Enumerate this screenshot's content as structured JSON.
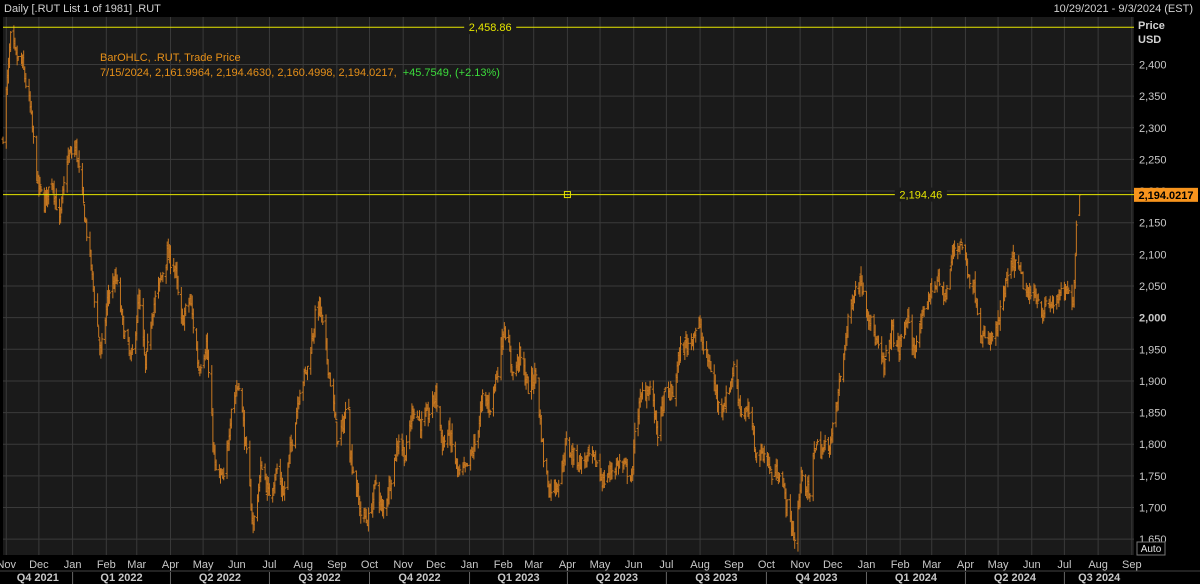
{
  "header": {
    "title": "Daily [.RUT List 1 of 1981] .RUT",
    "date_range": "10/29/2021 - 9/3/2024 (EST)"
  },
  "legend": {
    "series_label": "BarOHLC, .RUT, Trade Price",
    "ohlc_text": "7/15/2024, 2,161.9964, 2,194.4630, 2,160.4998, 2,194.0217,",
    "change_text": "+45.7549, (+2.13%)"
  },
  "axis_header": {
    "price": "Price",
    "currency": "USD"
  },
  "auto_button": "Auto",
  "colors": {
    "background": "#000000",
    "plot_background": "#1a1a1a",
    "grid": "#3a3a3a",
    "bars": "#c87820",
    "hline": "#e6e600",
    "legend_text": "#e69019",
    "change_text": "#3cdc3c",
    "axis_text": "#c8c8c8",
    "price_tag": "#f7941d"
  },
  "chart_data": {
    "type": "ohlc-bar",
    "y_ticks": [
      1650,
      1700,
      1750,
      1800,
      1850,
      1900,
      1950,
      2000,
      2050,
      2100,
      2150,
      2200,
      2250,
      2300,
      2350,
      2400
    ],
    "y_tick_labels": [
      "1,650",
      "1,700",
      "1,750",
      "1,800",
      "1,850",
      "1,900",
      "1,950",
      "2,000",
      "2,050",
      "2,100",
      "2,150",
      "2,200",
      "2,250",
      "2,300",
      "2,350",
      "2,400"
    ],
    "ylim": [
      1625,
      2475
    ],
    "x_range": [
      "2021-10-29",
      "2024-09-03"
    ],
    "month_labels": [
      {
        "label": "Nov",
        "date": "2021-11-01"
      },
      {
        "label": "Dec",
        "date": "2021-12-01"
      },
      {
        "label": "Jan",
        "date": "2022-01-01"
      },
      {
        "label": "Feb",
        "date": "2022-02-01"
      },
      {
        "label": "Mar",
        "date": "2022-03-01"
      },
      {
        "label": "Apr",
        "date": "2022-04-01"
      },
      {
        "label": "May",
        "date": "2022-05-01"
      },
      {
        "label": "Jun",
        "date": "2022-06-01"
      },
      {
        "label": "Jul",
        "date": "2022-07-01"
      },
      {
        "label": "Aug",
        "date": "2022-08-01"
      },
      {
        "label": "Sep",
        "date": "2022-09-01"
      },
      {
        "label": "Oct",
        "date": "2022-10-01"
      },
      {
        "label": "Nov",
        "date": "2022-11-01"
      },
      {
        "label": "Dec",
        "date": "2022-12-01"
      },
      {
        "label": "Jan",
        "date": "2023-01-01"
      },
      {
        "label": "Feb",
        "date": "2023-02-01"
      },
      {
        "label": "Mar",
        "date": "2023-03-01"
      },
      {
        "label": "Apr",
        "date": "2023-04-01"
      },
      {
        "label": "May",
        "date": "2023-05-01"
      },
      {
        "label": "Jun",
        "date": "2023-06-01"
      },
      {
        "label": "Jul",
        "date": "2023-07-01"
      },
      {
        "label": "Aug",
        "date": "2023-08-01"
      },
      {
        "label": "Sep",
        "date": "2023-09-01"
      },
      {
        "label": "Oct",
        "date": "2023-10-01"
      },
      {
        "label": "Nov",
        "date": "2023-11-01"
      },
      {
        "label": "Dec",
        "date": "2023-12-01"
      },
      {
        "label": "Jan",
        "date": "2024-01-01"
      },
      {
        "label": "Feb",
        "date": "2024-02-01"
      },
      {
        "label": "Mar",
        "date": "2024-03-01"
      },
      {
        "label": "Apr",
        "date": "2024-04-01"
      },
      {
        "label": "May",
        "date": "2024-05-01"
      },
      {
        "label": "Jun",
        "date": "2024-06-01"
      },
      {
        "label": "Jul",
        "date": "2024-07-01"
      },
      {
        "label": "Aug",
        "date": "2024-08-01"
      },
      {
        "label": "Sep",
        "date": "2024-09-01"
      }
    ],
    "quarter_labels": [
      {
        "label": "Q4 2021",
        "start": "2021-10-29",
        "end": "2022-01-01"
      },
      {
        "label": "Q1 2022",
        "start": "2022-01-01",
        "end": "2022-04-01"
      },
      {
        "label": "Q2 2022",
        "start": "2022-04-01",
        "end": "2022-07-01"
      },
      {
        "label": "Q3 2022",
        "start": "2022-07-01",
        "end": "2022-10-01"
      },
      {
        "label": "Q4 2022",
        "start": "2022-10-01",
        "end": "2023-01-01"
      },
      {
        "label": "Q1 2023",
        "start": "2023-01-01",
        "end": "2023-04-01"
      },
      {
        "label": "Q2 2023",
        "start": "2023-04-01",
        "end": "2023-07-01"
      },
      {
        "label": "Q3 2023",
        "start": "2023-07-01",
        "end": "2023-10-01"
      },
      {
        "label": "Q4 2023",
        "start": "2023-10-01",
        "end": "2024-01-01"
      },
      {
        "label": "Q1 2024",
        "start": "2024-01-01",
        "end": "2024-04-01"
      },
      {
        "label": "Q2 2024",
        "start": "2024-04-01",
        "end": "2024-07-01"
      },
      {
        "label": "Q3 2024",
        "start": "2024-07-01",
        "end": "2024-09-03"
      }
    ],
    "hlines": [
      {
        "value": 2458.86,
        "label": "2,458.86",
        "label_date": "2023-01-20"
      },
      {
        "value": 2194.46,
        "label": "2,194.46",
        "label_date": "2024-02-20"
      }
    ],
    "marker_date": "2023-04-01",
    "last_price": {
      "value": 2194.0217,
      "label": "2,194.0217"
    },
    "anchors": [
      [
        "2021-10-29",
        2290
      ],
      [
        "2021-11-05",
        2440
      ],
      [
        "2021-11-10",
        2410
      ],
      [
        "2021-11-16",
        2400
      ],
      [
        "2021-11-23",
        2330
      ],
      [
        "2021-11-30",
        2210
      ],
      [
        "2021-12-06",
        2180
      ],
      [
        "2021-12-13",
        2220
      ],
      [
        "2021-12-20",
        2150
      ],
      [
        "2021-12-27",
        2250
      ],
      [
        "2022-01-04",
        2270
      ],
      [
        "2022-01-10",
        2190
      ],
      [
        "2022-01-18",
        2080
      ],
      [
        "2022-01-27",
        1940
      ],
      [
        "2022-02-03",
        2040
      ],
      [
        "2022-02-10",
        2060
      ],
      [
        "2022-02-17",
        1980
      ],
      [
        "2022-02-24",
        1930
      ],
      [
        "2022-03-03",
        2030
      ],
      [
        "2022-03-09",
        1920
      ],
      [
        "2022-03-15",
        2010
      ],
      [
        "2022-03-23",
        2060
      ],
      [
        "2022-03-29",
        2100
      ],
      [
        "2022-04-05",
        2080
      ],
      [
        "2022-04-11",
        1990
      ],
      [
        "2022-04-19",
        2030
      ],
      [
        "2022-04-27",
        1920
      ],
      [
        "2022-05-04",
        1960
      ],
      [
        "2022-05-12",
        1760
      ],
      [
        "2022-05-20",
        1740
      ],
      [
        "2022-05-27",
        1860
      ],
      [
        "2022-06-03",
        1900
      ],
      [
        "2022-06-10",
        1780
      ],
      [
        "2022-06-16",
        1670
      ],
      [
        "2022-06-24",
        1770
      ],
      [
        "2022-06-30",
        1720
      ],
      [
        "2022-07-08",
        1760
      ],
      [
        "2022-07-14",
        1720
      ],
      [
        "2022-07-22",
        1810
      ],
      [
        "2022-07-29",
        1890
      ],
      [
        "2022-08-05",
        1920
      ],
      [
        "2022-08-12",
        2000
      ],
      [
        "2022-08-16",
        2020
      ],
      [
        "2022-08-26",
        1900
      ],
      [
        "2022-09-02",
        1800
      ],
      [
        "2022-09-12",
        1870
      ],
      [
        "2022-09-13",
        1790
      ],
      [
        "2022-09-23",
        1690
      ],
      [
        "2022-09-30",
        1680
      ],
      [
        "2022-10-07",
        1740
      ],
      [
        "2022-10-13",
        1690
      ],
      [
        "2022-10-21",
        1750
      ],
      [
        "2022-10-28",
        1810
      ],
      [
        "2022-11-03",
        1780
      ],
      [
        "2022-11-10",
        1860
      ],
      [
        "2022-11-18",
        1830
      ],
      [
        "2022-11-25",
        1850
      ],
      [
        "2022-12-01",
        1880
      ],
      [
        "2022-12-07",
        1800
      ],
      [
        "2022-12-13",
        1820
      ],
      [
        "2022-12-22",
        1750
      ],
      [
        "2022-12-29",
        1760
      ],
      [
        "2023-01-06",
        1800
      ],
      [
        "2023-01-13",
        1870
      ],
      [
        "2023-01-20",
        1860
      ],
      [
        "2023-01-27",
        1920
      ],
      [
        "2023-02-02",
        1990
      ],
      [
        "2023-02-10",
        1910
      ],
      [
        "2023-02-16",
        1940
      ],
      [
        "2023-02-24",
        1890
      ],
      [
        "2023-03-03",
        1910
      ],
      [
        "2023-03-10",
        1780
      ],
      [
        "2023-03-15",
        1730
      ],
      [
        "2023-03-24",
        1740
      ],
      [
        "2023-03-31",
        1800
      ],
      [
        "2023-04-07",
        1780
      ],
      [
        "2023-04-14",
        1770
      ],
      [
        "2023-04-21",
        1780
      ],
      [
        "2023-04-28",
        1770
      ],
      [
        "2023-05-04",
        1740
      ],
      [
        "2023-05-11",
        1760
      ],
      [
        "2023-05-19",
        1770
      ],
      [
        "2023-05-31",
        1750
      ],
      [
        "2023-06-02",
        1830
      ],
      [
        "2023-06-09",
        1880
      ],
      [
        "2023-06-16",
        1890
      ],
      [
        "2023-06-23",
        1820
      ],
      [
        "2023-06-30",
        1880
      ],
      [
        "2023-07-07",
        1880
      ],
      [
        "2023-07-14",
        1950
      ],
      [
        "2023-07-21",
        1960
      ],
      [
        "2023-07-31",
        1990
      ],
      [
        "2023-08-04",
        1950
      ],
      [
        "2023-08-11",
        1920
      ],
      [
        "2023-08-18",
        1860
      ],
      [
        "2023-08-25",
        1870
      ],
      [
        "2023-09-01",
        1920
      ],
      [
        "2023-09-08",
        1850
      ],
      [
        "2023-09-15",
        1850
      ],
      [
        "2023-09-22",
        1780
      ],
      [
        "2023-09-29",
        1790
      ],
      [
        "2023-10-06",
        1750
      ],
      [
        "2023-10-13",
        1760
      ],
      [
        "2023-10-20",
        1700
      ],
      [
        "2023-10-27",
        1650
      ],
      [
        "2023-11-03",
        1760
      ],
      [
        "2023-11-10",
        1710
      ],
      [
        "2023-11-14",
        1800
      ],
      [
        "2023-11-22",
        1790
      ],
      [
        "2023-11-30",
        1810
      ],
      [
        "2023-12-06",
        1880
      ],
      [
        "2023-12-13",
        1970
      ],
      [
        "2023-12-20",
        2040
      ],
      [
        "2023-12-27",
        2060
      ],
      [
        "2024-01-05",
        1990
      ],
      [
        "2024-01-17",
        1920
      ],
      [
        "2024-01-24",
        1980
      ],
      [
        "2024-01-31",
        1950
      ],
      [
        "2024-02-07",
        2000
      ],
      [
        "2024-02-13",
        1950
      ],
      [
        "2024-02-21",
        1990
      ],
      [
        "2024-02-28",
        2040
      ],
      [
        "2024-03-06",
        2060
      ],
      [
        "2024-03-14",
        2030
      ],
      [
        "2024-03-21",
        2110
      ],
      [
        "2024-03-28",
        2120
      ],
      [
        "2024-04-04",
        2070
      ],
      [
        "2024-04-10",
        2040
      ],
      [
        "2024-04-16",
        1970
      ],
      [
        "2024-04-22",
        1960
      ],
      [
        "2024-04-30",
        1980
      ],
      [
        "2024-05-08",
        2050
      ],
      [
        "2024-05-15",
        2090
      ],
      [
        "2024-05-21",
        2070
      ],
      [
        "2024-05-29",
        2030
      ],
      [
        "2024-06-04",
        2040
      ],
      [
        "2024-06-11",
        2010
      ],
      [
        "2024-06-18",
        2020
      ],
      [
        "2024-06-25",
        2030
      ],
      [
        "2024-07-02",
        2040
      ],
      [
        "2024-07-09",
        2030
      ],
      [
        "2024-07-11",
        2100
      ],
      [
        "2024-07-12",
        2149
      ],
      [
        "2024-07-15",
        2194
      ]
    ],
    "last_bar": {
      "date": "2024-07-15",
      "open": 2161.9964,
      "high": 2194.463,
      "low": 2160.4998,
      "close": 2194.0217
    }
  }
}
